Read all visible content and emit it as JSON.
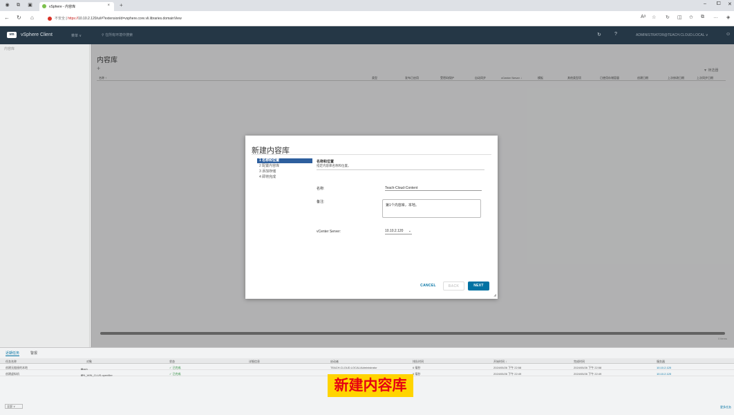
{
  "browser": {
    "tab_title": "vSphere - 内容库",
    "new_tab_icon": "+",
    "security_label": "不安全",
    "url_scheme": "https://",
    "url_rest": "10.10.2.120/ui/#?extensionId=vsphere.core.vli.libraries.domainView"
  },
  "header": {
    "logo": "vm",
    "app_name": "vSphere Client",
    "menu": "菜单 ∨",
    "search_placeholder": "在所有环境中搜索",
    "user": "ADMINISTRATOR@TEACH.CLOUD.LOCAL ∨"
  },
  "sidebar": {
    "placeholder": "内容库"
  },
  "main": {
    "title": "内容库",
    "add_icon": "+",
    "filter": "▼ 筛选器",
    "columns": [
      "名称 ↑",
      "类型",
      "发布已启用",
      "受密码保护",
      "自动同步",
      "vCenter Server ↓",
      "模板",
      "其他类型项",
      "已使用存储容量",
      "创建日期",
      "上次修改日期",
      "上次同步日期"
    ],
    "footer": "0 items"
  },
  "dialog": {
    "title": "新建内容库",
    "steps": [
      "1 名称和位置",
      "2 配置内容库",
      "3 添加存储",
      "4 即将完成"
    ],
    "section_title": "名称和位置",
    "section_desc": "指定内容库名称和位置。",
    "name_label": "名称:",
    "name_value": "Teach-Cloud-Content",
    "notes_label": "备注:",
    "notes_value": "第1个内容库，本地。",
    "vcenter_label": "vCenter Server:",
    "vcenter_value": "10.10.2.120",
    "cancel": "CANCEL",
    "back": "BACK",
    "next": "NEXT"
  },
  "tasks": {
    "tab_recent": "近期任务",
    "tab_alarms": "警报",
    "columns": [
      "任务名称",
      "对象",
      "状态",
      "详细信息",
      "启动者",
      "排队时间",
      "开始时间 ↓",
      "完成时间",
      "服务器"
    ],
    "rows": [
      [
        "创建无链接的本地",
        "teach",
        "✓ 已完成",
        "",
        "TEACH.CLOUD.LOCAL\\Administrator",
        "6 毫秒",
        "2024/05/26 下午 22:58",
        "2024/05/26 下午 22:58",
        "10.10.2.120"
      ],
      [
        "创建虚拟机",
        "IPK_WIN_CLUS.openfiler",
        "✓ 已完成",
        "",
        "",
        "5 毫秒",
        "2024/05/26 下午 22:49",
        "2024/05/26 下午 22:49",
        "10.10.2.120"
      ]
    ],
    "footer_select": "全部 ∨",
    "footer_more": "更多任务"
  },
  "caption": "新建内容库",
  "colors": {
    "header_bg": "#253746",
    "primary": "#0072a3",
    "caption_bg": "#ffd400",
    "caption_fg": "#e60012"
  }
}
